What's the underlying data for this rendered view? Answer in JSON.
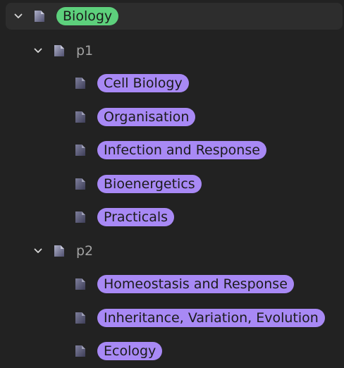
{
  "tree": {
    "root": {
      "label": "Biology",
      "expanded": true,
      "color": "#5dd07c",
      "icon": "page-icon",
      "children": [
        {
          "label": "p1",
          "expanded": true,
          "icon": "page-icon",
          "children": [
            {
              "label": "Cell Biology",
              "icon": "page-icon",
              "color": "#a889f5"
            },
            {
              "label": "Organisation",
              "icon": "page-icon",
              "color": "#a889f5"
            },
            {
              "label": "Infection and Response",
              "icon": "page-icon",
              "color": "#a889f5"
            },
            {
              "label": "Bioenergetics",
              "icon": "page-icon",
              "color": "#a889f5"
            },
            {
              "label": "Practicals",
              "icon": "page-icon",
              "color": "#a889f5"
            }
          ]
        },
        {
          "label": "p2",
          "expanded": true,
          "icon": "page-icon",
          "children": [
            {
              "label": "Homeostasis and Response",
              "icon": "page-icon",
              "color": "#a889f5"
            },
            {
              "label": "Inheritance, Variation, Evolution",
              "icon": "page-icon",
              "color": "#a889f5"
            },
            {
              "label": "Ecology",
              "icon": "page-icon",
              "color": "#a889f5"
            }
          ]
        }
      ]
    }
  }
}
